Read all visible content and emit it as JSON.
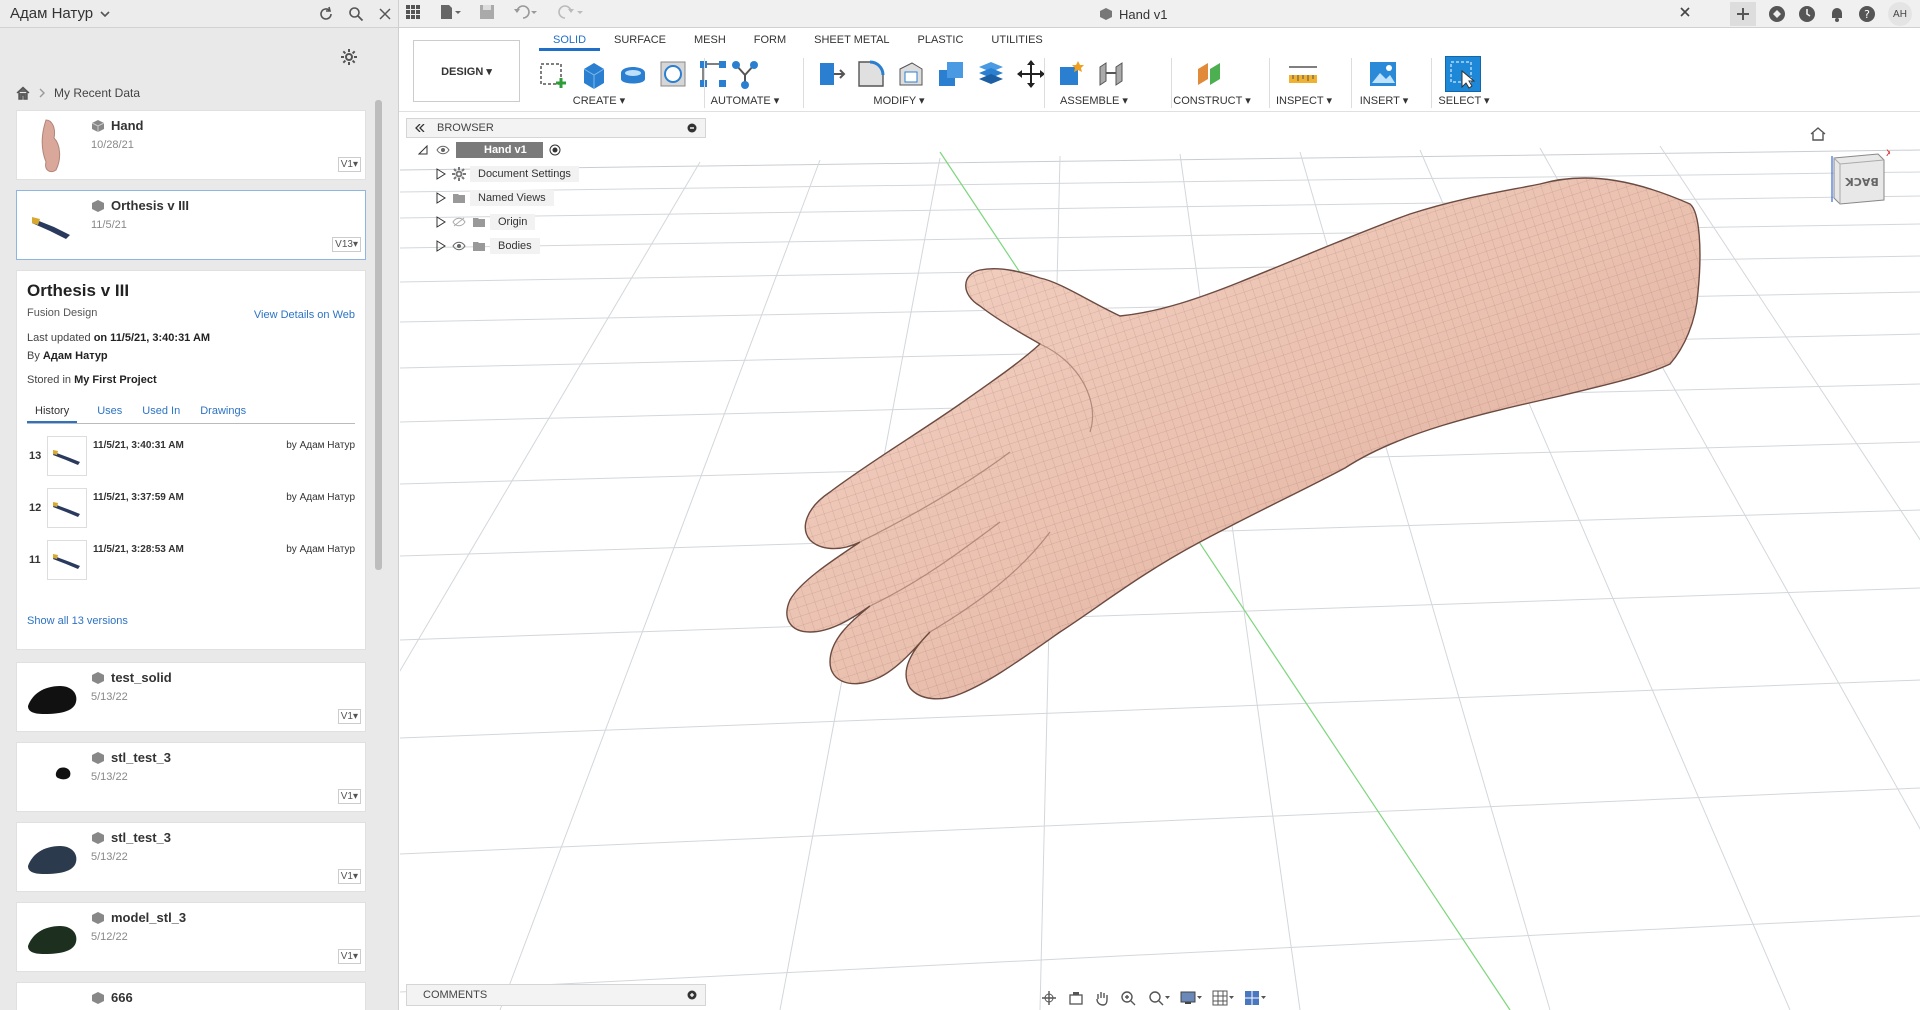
{
  "data_panel": {
    "user_name": "Адам Натур",
    "breadcrumb": "My Recent Data",
    "items": [
      {
        "name": "Hand",
        "date": "10/28/21",
        "version": "V1"
      },
      {
        "name": "Orthesis v III",
        "date": "11/5/21",
        "version": "V13"
      }
    ],
    "more_items": [
      {
        "name": "test_solid",
        "date": "5/13/22",
        "version": "V1"
      },
      {
        "name": "stl_test_3",
        "date": "5/13/22",
        "version": "V1"
      },
      {
        "name": "stl_test_3",
        "date": "5/13/22",
        "version": "V1"
      },
      {
        "name": "model_stl_3",
        "date": "5/12/22",
        "version": "V1"
      },
      {
        "name": "666",
        "date": "",
        "version": ""
      }
    ],
    "details": {
      "title": "Orthesis v III",
      "type": "Fusion Design",
      "web_link": "View Details on Web",
      "updated_label": "Last updated",
      "updated_on": "on 11/5/21, 3:40:31 AM",
      "by_label": "By",
      "by_user": "Адам Натур",
      "stored_label": "Stored in",
      "stored_project": "My First Project",
      "tabs": [
        "History",
        "Uses",
        "Used In",
        "Drawings"
      ],
      "history": [
        {
          "num": "13",
          "date": "11/5/21, 3:40:31 AM",
          "by": "by Адам Натур"
        },
        {
          "num": "12",
          "date": "11/5/21, 3:37:59 AM",
          "by": "by Адам Натур"
        },
        {
          "num": "11",
          "date": "11/5/21, 3:28:53 AM",
          "by": "by Адам Натур"
        }
      ],
      "show_all": "Show all 13 versions"
    }
  },
  "topbar": {
    "doc_title": "Hand v1",
    "avatar": "AH"
  },
  "ribbon": {
    "design_label": "DESIGN ▾",
    "tabs": [
      "SOLID",
      "SURFACE",
      "MESH",
      "FORM",
      "SHEET METAL",
      "PLASTIC",
      "UTILITIES"
    ],
    "groups": {
      "create": "CREATE ▾",
      "automate": "AUTOMATE ▾",
      "modify": "MODIFY ▾",
      "assemble": "ASSEMBLE ▾",
      "construct": "CONSTRUCT ▾",
      "inspect": "INSPECT ▾",
      "insert": "INSERT ▾",
      "select": "SELECT ▾"
    }
  },
  "browser": {
    "title": "BROWSER",
    "root": "Hand v1",
    "nodes": [
      "Document Settings",
      "Named Views",
      "Origin",
      "Bodies"
    ]
  },
  "comments": {
    "title": "COMMENTS"
  },
  "viewcube": {
    "face": "BACK"
  },
  "colors": {
    "accent": "#1f6fc9",
    "skin": "#eec5b4",
    "grid": "#c8ccd0"
  }
}
